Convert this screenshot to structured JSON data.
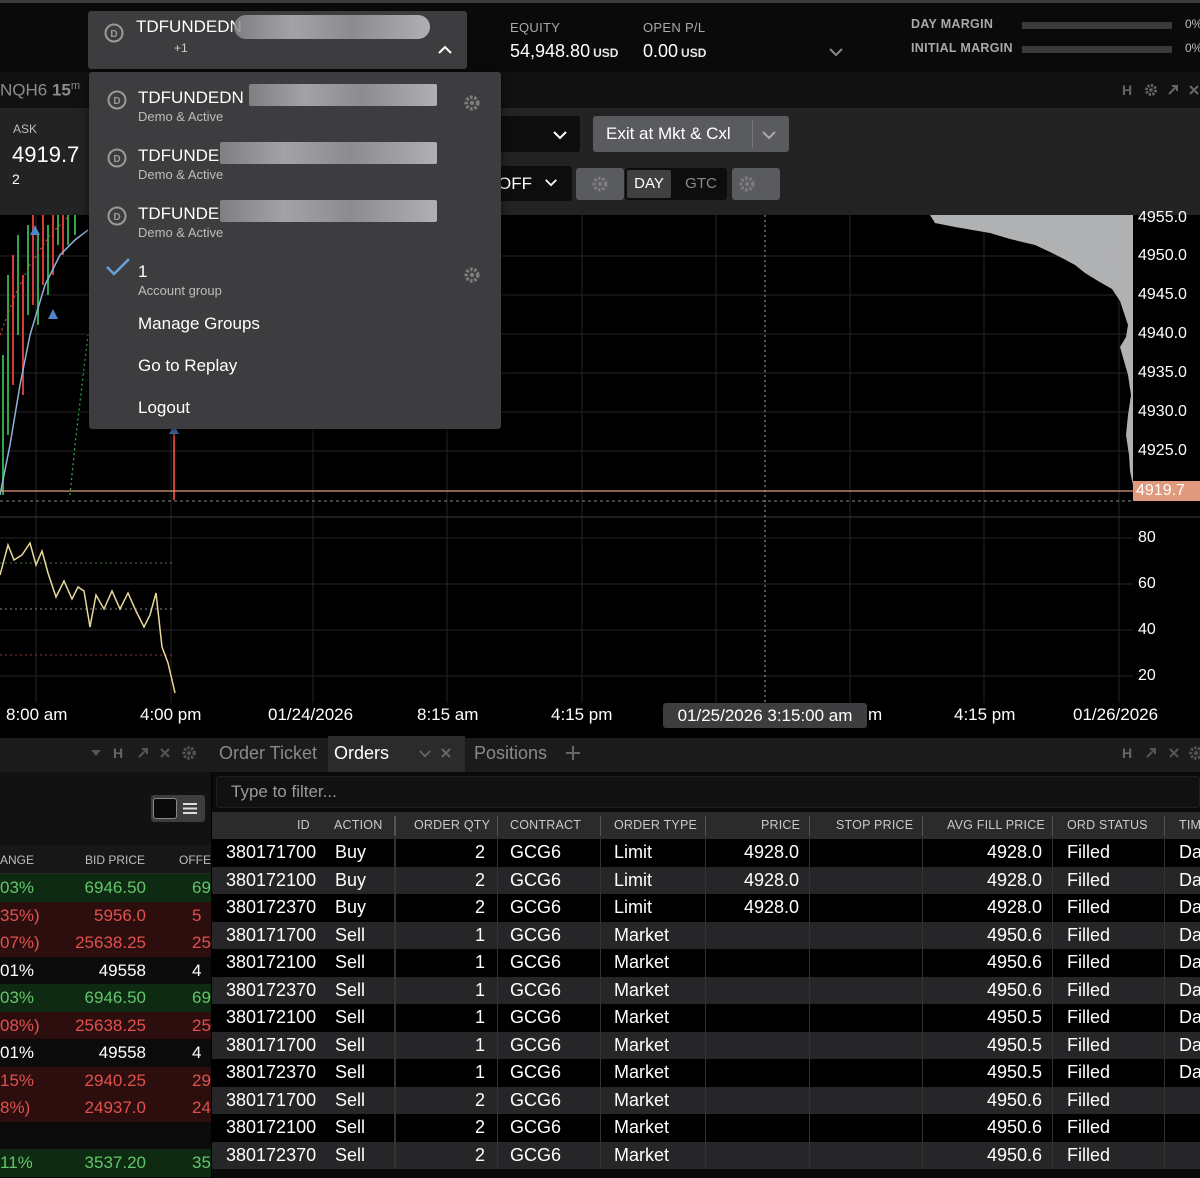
{
  "account": {
    "name": "TDFUNDEDN",
    "sub": "+1"
  },
  "equity": {
    "label": "EQUITY",
    "value": "54,948.80",
    "unit": "USD"
  },
  "open_pl": {
    "label": "OPEN P/L",
    "value": "0.00",
    "unit": "USD"
  },
  "margins": {
    "day_label": "DAY MARGIN",
    "day_pct": "0%",
    "day_fill": 0,
    "initial_label": "INITIAL MARGIN",
    "initial_pct": "0%",
    "initial_fill": 0
  },
  "chart_header": {
    "symbol": "NQH6",
    "interval": "15",
    "interval_unit": "m"
  },
  "ticket": {
    "ask_label": "ASK",
    "ask_value": "4919.7",
    "ask_qty": "2",
    "exit_label": "Exit at Mkt & Cxl",
    "off_label": "OFF",
    "tif_day": "DAY",
    "tif_gtc": "GTC"
  },
  "menu": {
    "accounts": [
      {
        "name": "TDFUNDEDN",
        "status": "Demo & Active"
      },
      {
        "name": "TDFUNDE",
        "status": "Demo & Active"
      },
      {
        "name": "TDFUNDE",
        "status": "Demo & Active"
      }
    ],
    "group": {
      "name": "1",
      "label": "Account group"
    },
    "links": [
      "Manage Groups",
      "Go to Replay",
      "Logout"
    ]
  },
  "chart": {
    "price_ticks": [
      "4955.0",
      "4950.0",
      "4945.0",
      "4940.0",
      "4935.0",
      "4930.0",
      "4925.0"
    ],
    "last_price": "4919.7",
    "osc_ticks": [
      "80",
      "60",
      "40",
      "20"
    ],
    "time_labels": [
      "8:00 am",
      "4:00 pm",
      "01/24/2026",
      "8:15 am",
      "4:15 pm",
      "m",
      "4:15 pm",
      "01/26/2026"
    ],
    "cursor_time": "01/25/2026 3:15:00 am"
  },
  "tabs": {
    "order_ticket": "Order Ticket",
    "orders": "Orders",
    "positions": "Positions"
  },
  "left_panel": {
    "columns": [
      "ANGE",
      "BID PRICE",
      "OFFE"
    ],
    "rows": [
      {
        "chg": "03%",
        "bid": "6946.50",
        "off": "69",
        "color": "g"
      },
      {
        "chg": "35%)",
        "bid": "5956.0",
        "off": "5",
        "color": "r"
      },
      {
        "chg": "07%)",
        "bid": "25638.25",
        "off": "256",
        "color": "r"
      },
      {
        "chg": "01%",
        "bid": "49558",
        "off": "4",
        "color": "n"
      },
      {
        "chg": "03%",
        "bid": "6946.50",
        "off": "69",
        "color": "g"
      },
      {
        "chg": "08%)",
        "bid": "25638.25",
        "off": "256",
        "color": "r"
      },
      {
        "chg": "01%",
        "bid": "49558",
        "off": "4",
        "color": "n"
      },
      {
        "chg": "15%",
        "bid": "2940.25",
        "off": "29",
        "color": "r"
      },
      {
        "chg": "8%)",
        "bid": "24937.0",
        "off": "24",
        "color": "r"
      },
      {
        "chg": "",
        "bid": "",
        "off": "",
        "color": "e"
      },
      {
        "chg": "11%",
        "bid": "3537.20",
        "off": "35",
        "color": "g"
      }
    ]
  },
  "orders": {
    "filter_placeholder": "Type to filter...",
    "columns": [
      "ID",
      "ACTION",
      "ORDER QTY",
      "CONTRACT",
      "ORDER TYPE",
      "PRICE",
      "STOP PRICE",
      "AVG FILL PRICE",
      "ORD STATUS",
      "TIM"
    ],
    "rows": [
      [
        "380171700",
        "Buy",
        "2",
        "GCG6",
        "Limit",
        "4928.0",
        "",
        "4928.0",
        "Filled",
        "Da"
      ],
      [
        "380172100",
        "Buy",
        "2",
        "GCG6",
        "Limit",
        "4928.0",
        "",
        "4928.0",
        "Filled",
        "Da"
      ],
      [
        "380172370",
        "Buy",
        "2",
        "GCG6",
        "Limit",
        "4928.0",
        "",
        "4928.0",
        "Filled",
        "Da"
      ],
      [
        "380171700",
        "Sell",
        "1",
        "GCG6",
        "Market",
        "",
        "",
        "4950.6",
        "Filled",
        "Da"
      ],
      [
        "380172100",
        "Sell",
        "1",
        "GCG6",
        "Market",
        "",
        "",
        "4950.6",
        "Filled",
        "Da"
      ],
      [
        "380172370",
        "Sell",
        "1",
        "GCG6",
        "Market",
        "",
        "",
        "4950.6",
        "Filled",
        "Da"
      ],
      [
        "380172100",
        "Sell",
        "1",
        "GCG6",
        "Market",
        "",
        "",
        "4950.5",
        "Filled",
        "Da"
      ],
      [
        "380171700",
        "Sell",
        "1",
        "GCG6",
        "Market",
        "",
        "",
        "4950.5",
        "Filled",
        "Da"
      ],
      [
        "380172370",
        "Sell",
        "1",
        "GCG6",
        "Market",
        "",
        "",
        "4950.5",
        "Filled",
        "Da"
      ],
      [
        "380171700",
        "Sell",
        "2",
        "GCG6",
        "Market",
        "",
        "",
        "4950.6",
        "Filled",
        ""
      ],
      [
        "380172100",
        "Sell",
        "2",
        "GCG6",
        "Market",
        "",
        "",
        "4950.6",
        "Filled",
        ""
      ],
      [
        "380172370",
        "Sell",
        "2",
        "GCG6",
        "Market",
        "",
        "",
        "4950.6",
        "Filled",
        ""
      ]
    ]
  }
}
